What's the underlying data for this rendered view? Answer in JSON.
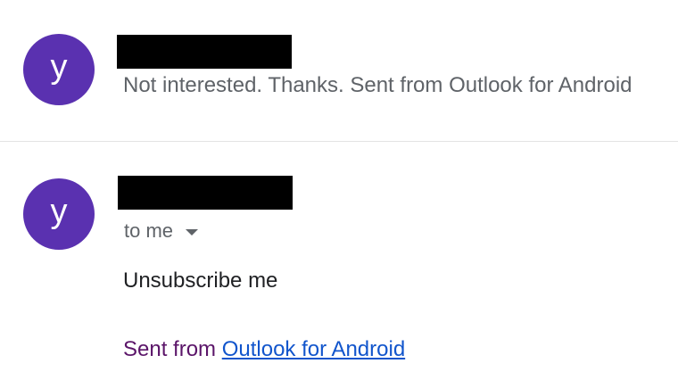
{
  "thread": {
    "message_1": {
      "avatar_letter": "y",
      "snippet": "Not interested. Thanks. Sent from Outlook for Android"
    },
    "message_2": {
      "avatar_letter": "y",
      "recipient_label": "to me",
      "body": "Unsubscribe me",
      "signature_prefix": "Sent from ",
      "signature_link": "Outlook for Android"
    }
  },
  "colors": {
    "avatar_bg": "#5a31b0",
    "link": "#1155cc",
    "signature_prefix": "#5b1569",
    "redaction": "#000000"
  },
  "icons": {
    "recipient_details_toggle": "caret-down-icon"
  }
}
